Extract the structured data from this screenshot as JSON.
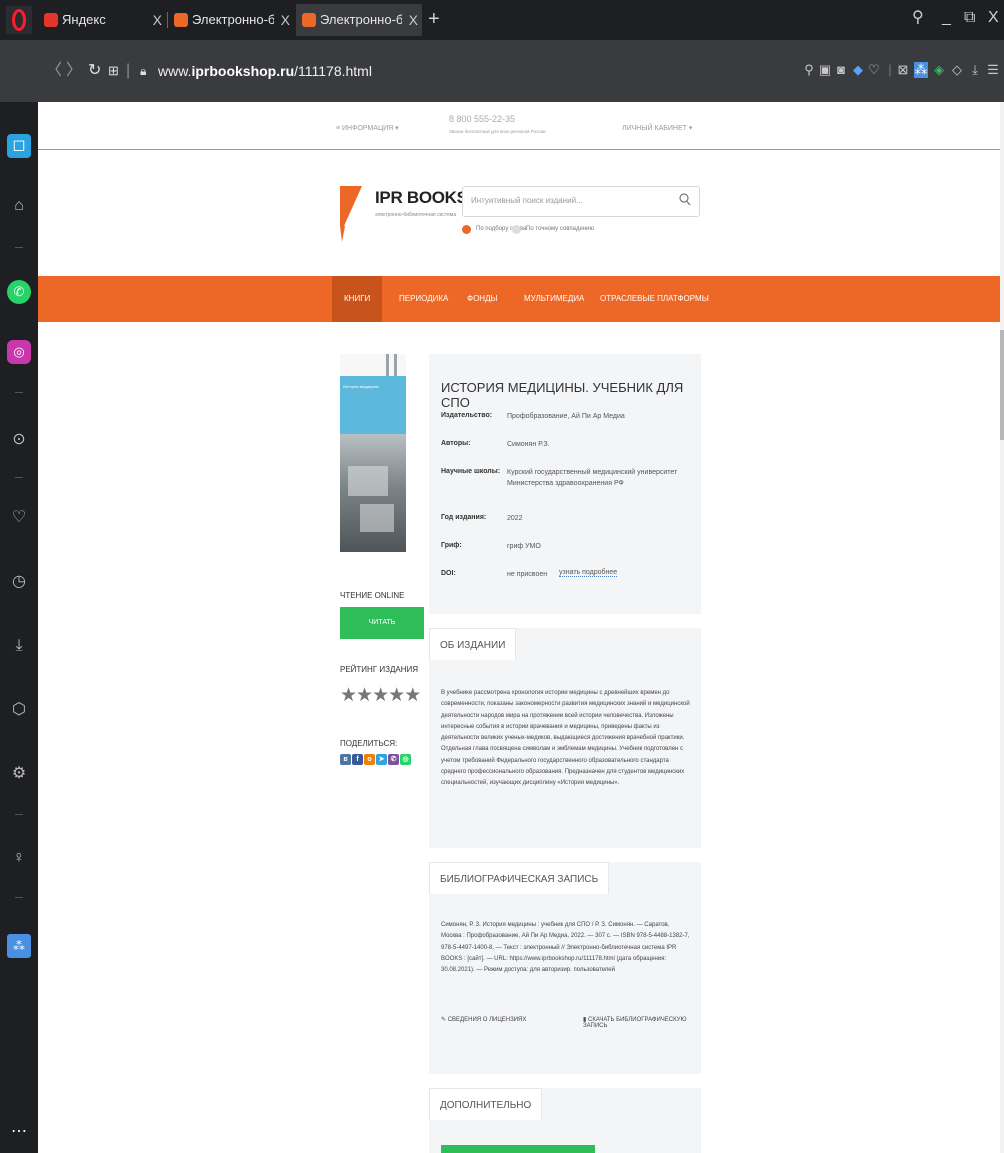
{
  "browser": {
    "tabs": [
      {
        "label": "Яндекс",
        "active": false
      },
      {
        "label": "Электронно-библиотечна",
        "active": false
      },
      {
        "label": "Электронно-библиотечна",
        "active": true
      }
    ],
    "new_tab": "+",
    "url_prefix": "www.",
    "url_domain": "iprbookshop.ru",
    "url_path": "/111178.html",
    "tab_close": "X",
    "window_controls": {
      "search": "⚲",
      "minimize": "_",
      "restore": "⧉",
      "close": "X"
    }
  },
  "site": {
    "top_info": "≡ ИНФОРМАЦИЯ ▾",
    "phone": "8 800 555-22-35",
    "phone_note": "Звонок бесплатный для всех регионов России",
    "account": "ЛИЧНЫЙ КАБИНЕТ ▾",
    "logo_text": "IPR BOOKS",
    "logo_sub": "электронно-библиотечная система",
    "search_placeholder": "Интуитивный поиск изданий...",
    "search_opt1": "По подбору слова",
    "search_opt2": "По точному совпадению",
    "nav": [
      "КНИГИ",
      "ПЕРИОДИКА",
      "ФОНДЫ",
      "МУЛЬТИМЕДИА",
      "ОТРАСЛЕВЫЕ ПЛАТФОРМЫ"
    ],
    "brand_color": "#ed6727",
    "accent_green": "#2ebd59"
  },
  "book": {
    "title": "ИСТОРИЯ МЕДИЦИНЫ. УЧЕБНИК ДЛЯ СПО",
    "cover_title": "История медицины",
    "fields": [
      {
        "label": "Издательство:",
        "value": "Профобразование, Ай Пи Ар Медиа"
      },
      {
        "label": "Авторы:",
        "value": "Симонян Р.З."
      },
      {
        "label": "Научные школы:",
        "value": "Курский государственный медицинский университет Министерства здравоохранения РФ"
      },
      {
        "label": "Год издания:",
        "value": "2022"
      },
      {
        "label": "Гриф:",
        "value": "гриф УМО"
      },
      {
        "label": "DOI:",
        "value": "не присвоен"
      }
    ],
    "doi_more": "узнать подробнее",
    "read_online_label": "ЧТЕНИЕ ONLINE",
    "read_button": "ЧИТАТЬ",
    "rating_label": "РЕЙТИНГ ИЗДАНИЯ",
    "rating": 5,
    "rating_max": 5,
    "share_label": "ПОДЕЛИТЬСЯ:"
  },
  "about": {
    "tab": "ОБ ИЗДАНИИ",
    "text": "В учебнике рассмотрена хронология истории медицины с древнейших времен до современности, показаны закономерности развития медицинских знаний и медицинской деятельности народов мира на протяжении всей истории человечества. Изложены интересные события в истории врачевания и медицины, приведены факты из деятельности великих ученых-медиков, выдающиеся достижения врачебной практики. Отдельная глава посвящена символам и эмблемам медицины. Учебник подготовлен с учетом требований Федерального государственного образовательного стандарта среднего профессионального образования. Предназначен для студентов медицинских специальностей, изучающих дисциплину «История медицины»."
  },
  "biblio": {
    "tab": "БИБЛИОГРАФИЧЕСКАЯ ЗАПИСЬ",
    "text": "Симонян, Р. З. История медицины : учебник для СПО / Р. З. Симонян. — Саратов, Москва : Профобразование, Ай Пи Ар Медиа, 2022. — 307 c. — ISBN 978-5-4488-1382-7, 978-5-4497-1400-8. — Текст : электронный // Электронно-библиотечная система IPR BOOKS : [сайт]. — URL: https://www.iprbookshop.ru/111178.html (дата обращения: 30.08.2021). — Режим доступа: для авторизир. пользователей",
    "license_link": "СВЕДЕНИЯ О ЛИЦЕНЗИЯХ",
    "download_link": "СКАЧАТЬ БИБЛИОГРАФИЧЕСКУЮ ЗАПИСЬ"
  },
  "extra": {
    "tab": "ДОПОЛНИТЕЛЬНО"
  }
}
